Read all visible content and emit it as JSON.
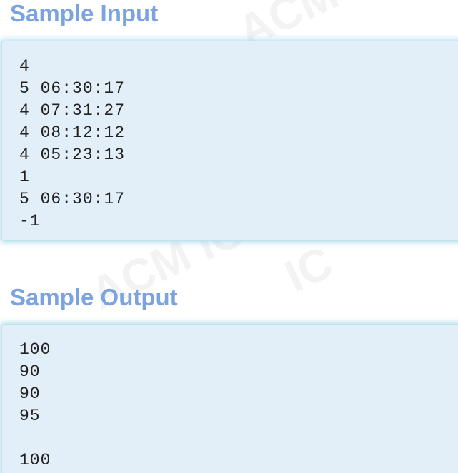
{
  "sample_input": {
    "title": "Sample Input",
    "lines": [
      "4",
      "5 06:30:17",
      "4 07:31:27",
      "4 08:12:12",
      "4 05:23:13",
      "1",
      "5 06:30:17",
      "-1"
    ]
  },
  "sample_output": {
    "title": "Sample Output",
    "lines": [
      "100",
      "90",
      "90",
      "95",
      "",
      "100"
    ]
  },
  "colors": {
    "title": "#7aa3e0",
    "box_background": "#e2eff8",
    "box_border": "#bfe3ee"
  }
}
